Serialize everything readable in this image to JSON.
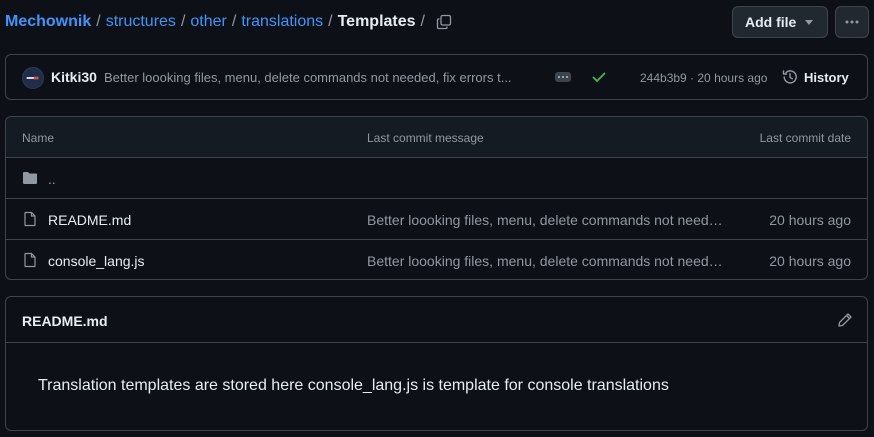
{
  "breadcrumb": {
    "repo": "Mechownik",
    "segments": [
      "structures",
      "other",
      "translations"
    ],
    "current": "Templates",
    "trailing_sep": "/"
  },
  "toolbar": {
    "add_file_label": "Add file",
    "more_icon": "kebab-horizontal-icon",
    "copy_icon": "copy-icon"
  },
  "commit": {
    "avatar_icon": "user-avatar",
    "author": "Kitki30",
    "message": "Better loooking files, menu, delete commands not needed, fix errors t...",
    "status_icon": "check-icon",
    "status_color": "#3fb950",
    "meta": "244b3b9 · 20 hours ago",
    "history_label": "History",
    "history_icon": "history-icon"
  },
  "table": {
    "headers": {
      "name": "Name",
      "message": "Last commit message",
      "date": "Last commit date"
    },
    "rows": [
      {
        "type": "parent-directory",
        "icon": "folder-icon",
        "name": "..",
        "message": "",
        "date": ""
      },
      {
        "type": "file",
        "icon": "file-icon",
        "name": "README.md",
        "message": "Better loooking files, menu, delete commands not neede...",
        "date": "20 hours ago"
      },
      {
        "type": "file",
        "icon": "file-icon",
        "name": "console_lang.js",
        "message": "Better loooking files, menu, delete commands not neede...",
        "date": "20 hours ago"
      }
    ]
  },
  "readme": {
    "title": "README.md",
    "edit_icon": "pencil-icon",
    "body": "Translation templates are stored here console_lang.js is template for console translations"
  },
  "colors": {
    "background": "#0d1117",
    "link": "#4493f8",
    "border": "#3d444d",
    "muted": "#9198a1",
    "success": "#3fb950"
  }
}
